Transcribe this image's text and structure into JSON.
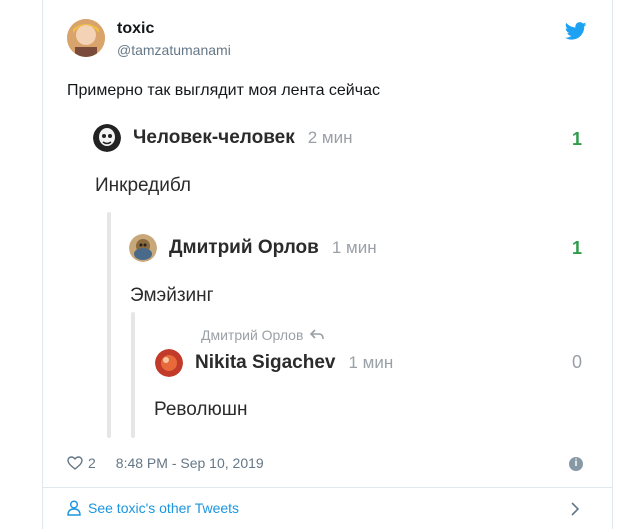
{
  "tweet": {
    "author_name": "toxic",
    "author_handle": "@tamzatumanami",
    "text": "Примерно так выглядит моя лента сейчас",
    "likes": "2",
    "timestamp": "8:48 PM - Sep 10, 2019",
    "see_more": "See toxic's other Tweets"
  },
  "embedded_thread": {
    "comments": [
      {
        "author": "Человек-человек",
        "time": "2 мин",
        "text": "Инкредибл",
        "score": "1"
      },
      {
        "author": "Дмитрий Орлов",
        "time": "1 мин",
        "text": "Эмэйзинг",
        "score": "1"
      },
      {
        "reply_to": "Дмитрий Орлов",
        "author": "Nikita Sigachev",
        "time": "1 мин",
        "text": "Революшн",
        "score": "0"
      }
    ]
  },
  "colors": {
    "twitter_blue": "#1da1f2",
    "link_blue": "#1b95e0",
    "score_positive": "#2e9c4a",
    "score_neutral": "#9aa0a6"
  },
  "icons": [
    "twitter-bird-icon",
    "heart-icon",
    "info-icon",
    "person-icon",
    "chevron-right-icon"
  ]
}
